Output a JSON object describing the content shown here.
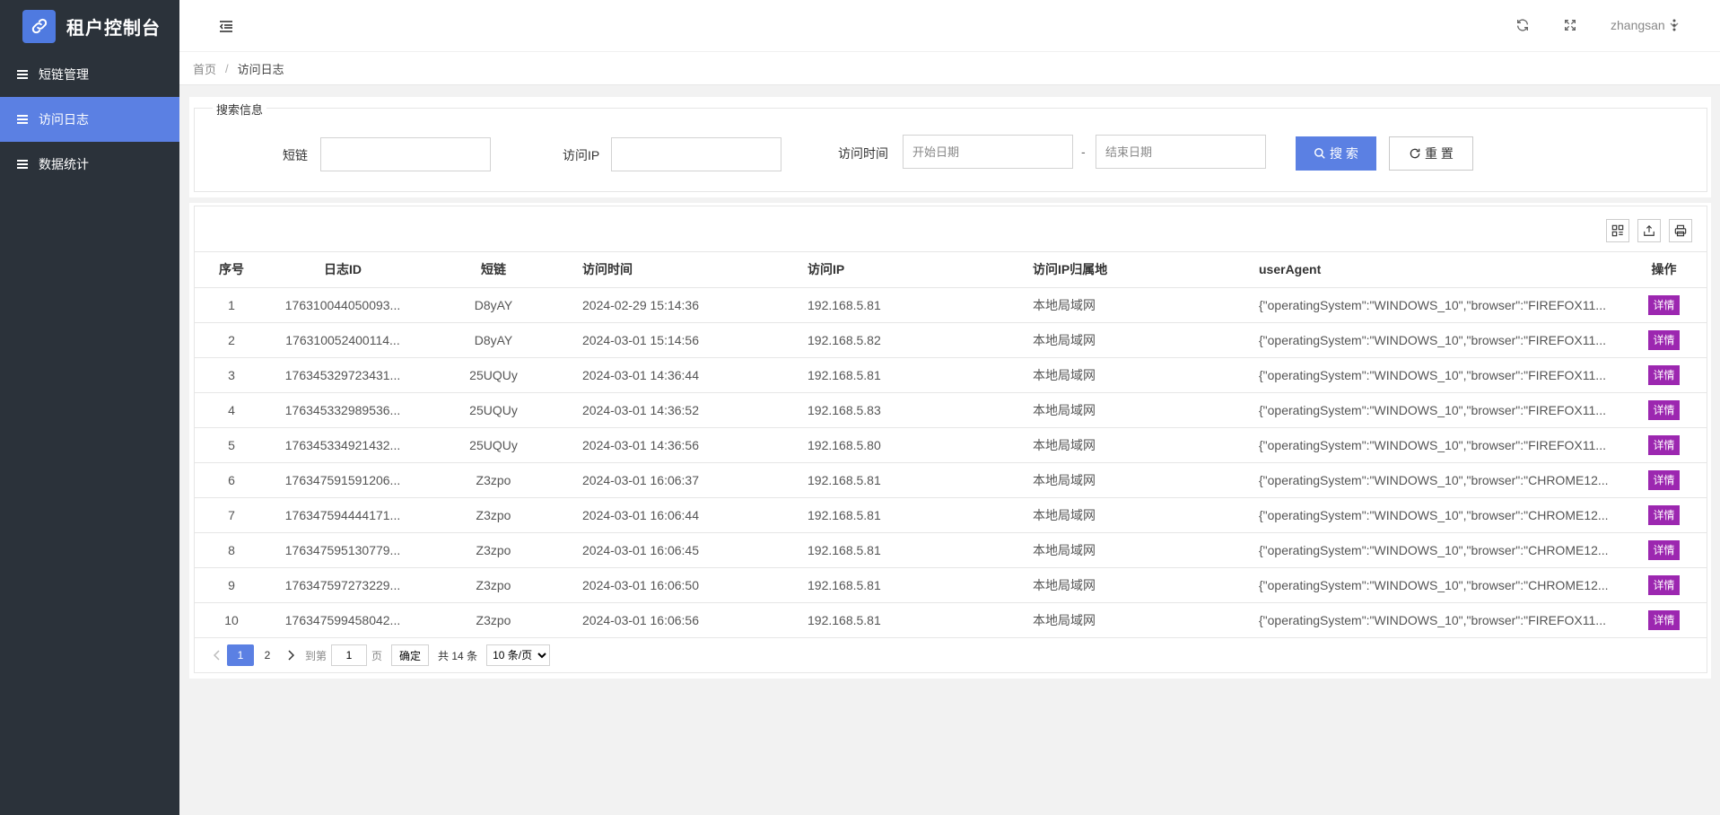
{
  "app": {
    "title": "租户控制台"
  },
  "sidebar": {
    "items": [
      {
        "label": "短链管理",
        "active": false
      },
      {
        "label": "访问日志",
        "active": true
      },
      {
        "label": "数据统计",
        "active": false
      }
    ]
  },
  "header": {
    "username": "zhangsan"
  },
  "breadcrumb": {
    "home": "首页",
    "separator": "/",
    "current": "访问日志"
  },
  "search": {
    "legend": "搜索信息",
    "shortlink_label": "短链",
    "shortlink_value": "",
    "ip_label": "访问IP",
    "ip_value": "",
    "time_label": "访问时间",
    "start_placeholder": "开始日期",
    "end_placeholder": "结束日期",
    "range_sep": "-",
    "search_button": "搜 索",
    "reset_button": "重 置"
  },
  "table": {
    "columns": [
      "序号",
      "日志ID",
      "短链",
      "访问时间",
      "访问IP",
      "访问IP归属地",
      "userAgent",
      "操作"
    ],
    "action_label": "详情",
    "rows": [
      {
        "no": "1",
        "id": "176310044050093...",
        "short": "D8yAY",
        "time": "2024-02-29 15:14:36",
        "ip": "192.168.5.81",
        "loc": "本地局域网",
        "ua": "{\"operatingSystem\":\"WINDOWS_10\",\"browser\":\"FIREFOX11..."
      },
      {
        "no": "2",
        "id": "176310052400114...",
        "short": "D8yAY",
        "time": "2024-03-01 15:14:56",
        "ip": "192.168.5.82",
        "loc": "本地局域网",
        "ua": "{\"operatingSystem\":\"WINDOWS_10\",\"browser\":\"FIREFOX11..."
      },
      {
        "no": "3",
        "id": "176345329723431...",
        "short": "25UQUy",
        "time": "2024-03-01 14:36:44",
        "ip": "192.168.5.81",
        "loc": "本地局域网",
        "ua": "{\"operatingSystem\":\"WINDOWS_10\",\"browser\":\"FIREFOX11..."
      },
      {
        "no": "4",
        "id": "176345332989536...",
        "short": "25UQUy",
        "time": "2024-03-01 14:36:52",
        "ip": "192.168.5.83",
        "loc": "本地局域网",
        "ua": "{\"operatingSystem\":\"WINDOWS_10\",\"browser\":\"FIREFOX11..."
      },
      {
        "no": "5",
        "id": "176345334921432...",
        "short": "25UQUy",
        "time": "2024-03-01 14:36:56",
        "ip": "192.168.5.80",
        "loc": "本地局域网",
        "ua": "{\"operatingSystem\":\"WINDOWS_10\",\"browser\":\"FIREFOX11..."
      },
      {
        "no": "6",
        "id": "176347591591206...",
        "short": "Z3zpo",
        "time": "2024-03-01 16:06:37",
        "ip": "192.168.5.81",
        "loc": "本地局域网",
        "ua": "{\"operatingSystem\":\"WINDOWS_10\",\"browser\":\"CHROME12..."
      },
      {
        "no": "7",
        "id": "176347594444171...",
        "short": "Z3zpo",
        "time": "2024-03-01 16:06:44",
        "ip": "192.168.5.81",
        "loc": "本地局域网",
        "ua": "{\"operatingSystem\":\"WINDOWS_10\",\"browser\":\"CHROME12..."
      },
      {
        "no": "8",
        "id": "176347595130779...",
        "short": "Z3zpo",
        "time": "2024-03-01 16:06:45",
        "ip": "192.168.5.81",
        "loc": "本地局域网",
        "ua": "{\"operatingSystem\":\"WINDOWS_10\",\"browser\":\"CHROME12..."
      },
      {
        "no": "9",
        "id": "176347597273229...",
        "short": "Z3zpo",
        "time": "2024-03-01 16:06:50",
        "ip": "192.168.5.81",
        "loc": "本地局域网",
        "ua": "{\"operatingSystem\":\"WINDOWS_10\",\"browser\":\"CHROME12..."
      },
      {
        "no": "10",
        "id": "176347599458042...",
        "short": "Z3zpo",
        "time": "2024-03-01 16:06:56",
        "ip": "192.168.5.81",
        "loc": "本地局域网",
        "ua": "{\"operatingSystem\":\"WINDOWS_10\",\"browser\":\"FIREFOX11..."
      }
    ]
  },
  "pagination": {
    "pages": [
      "1",
      "2"
    ],
    "current": "1",
    "goto_label": "到第",
    "goto_value": "1",
    "page_unit": "页",
    "confirm": "确定",
    "total": "共 14 条",
    "page_size": "10 条/页"
  },
  "icons": {
    "logo": "link-icon",
    "menu": "list-icon",
    "toggle": "indent-icon",
    "refresh": "refresh-icon",
    "fullscreen": "expand-icon",
    "more": "more-vertical-icon",
    "columns": "columns-icon",
    "export": "export-icon",
    "print": "print-icon"
  },
  "colors": {
    "sidebar_bg": "#2b323a",
    "accent": "#5b80e3",
    "detail_button": "#9c27b0"
  }
}
